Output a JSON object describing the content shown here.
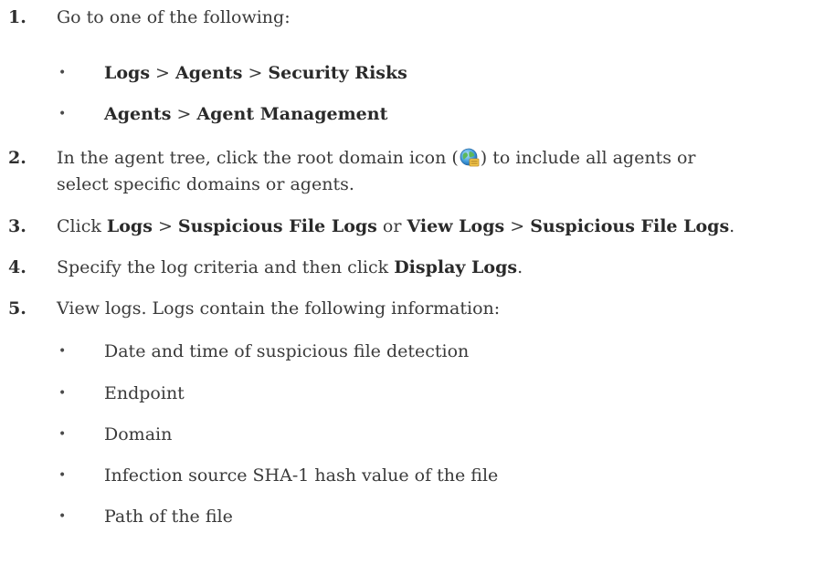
{
  "steps": {
    "s1": {
      "num": "1.",
      "text": "Go to one of the following:",
      "options": [
        {
          "a": "Logs",
          "sep1": " > ",
          "b": "Agents",
          "sep2": " > ",
          "c": "Security Risks"
        },
        {
          "a": "Agents",
          "sep1": " > ",
          "b": "Agent Management"
        }
      ]
    },
    "s2": {
      "num": "2.",
      "line1_before": "In the agent tree, click the root domain icon (",
      "line1_after": ") to include all agents or",
      "line2": "select specific domains or agents.",
      "icon": "globe-domain-icon"
    },
    "s3": {
      "num": "3.",
      "t1": "Click ",
      "b1": "Logs",
      "t2": " > ",
      "b2": "Suspicious File Logs",
      "t3": " or ",
      "b3": "View Logs",
      "t4": " > ",
      "b4": "Suspicious File Logs",
      "t5": "."
    },
    "s4": {
      "num": "4.",
      "t1": "Specify the log criteria and then click ",
      "b1": "Display Logs",
      "t2": "."
    },
    "s5": {
      "num": "5.",
      "text": "View logs. Logs contain the following information:",
      "items": [
        "Date and time of suspicious file detection",
        "Endpoint",
        "Domain",
        "Infection source SHA-1 hash value of the file",
        "Path of the file"
      ]
    }
  },
  "bullet_char": "•"
}
